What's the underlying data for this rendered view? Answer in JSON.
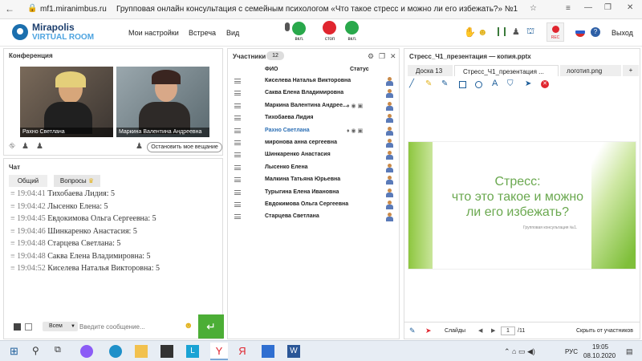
{
  "browser": {
    "url": "mf1.miranimbus.ru",
    "title": "Групповая онлайн консультация с семейным психологом «Что такое стресс и можно ли его избежать?» №1"
  },
  "app": {
    "logo_top": "Mirapolis",
    "logo_bottom": "VIRTUAL ROOM",
    "nav": [
      "Мои настройки",
      "Встреча",
      "Вид"
    ],
    "mic_label": "вкл.",
    "stop_label": "стоп",
    "cam_label": "вкл.",
    "rec_label": "REC",
    "exit_label": "Выход"
  },
  "conference": {
    "title": "Конференция",
    "videos": [
      {
        "name": "Рахно Светлана"
      },
      {
        "name": "Маркина Валентина Андреевна"
      }
    ],
    "stop_button": "Остановить мое вещание"
  },
  "chat": {
    "title": "Чат",
    "tabs": [
      "Общий",
      "Вопросы"
    ],
    "messages": [
      {
        "time": "19:04:41",
        "text": "Тихобаева Лидия: 5"
      },
      {
        "time": "19:04:42",
        "text": "Лысенко Елена: 5"
      },
      {
        "time": "19:04:45",
        "text": "Евдокимова Ольга  Сергеевна: 5"
      },
      {
        "time": "19:04:46",
        "text": "Шинкаренко  Анастасия: 5"
      },
      {
        "time": "19:04:48",
        "text": "Старцева Светлана: 5"
      },
      {
        "time": "19:04:48",
        "text": "Саква Елена Владимировна: 5"
      },
      {
        "time": "19:04:52",
        "text": "Киселева  Наталья Викторовна:  5"
      }
    ],
    "scope": "Всем",
    "placeholder": "Введите сообщение..."
  },
  "participants": {
    "title": "Участники",
    "count": "12",
    "col_name": "ФИО",
    "col_status": "Статус",
    "rows": [
      {
        "name": "Киселева  Наталья Викторовна",
        "color": "#222"
      },
      {
        "name": "Саква Елена Владимировна",
        "color": "#222"
      },
      {
        "name": "Маркина Валентина  Андрее...",
        "color": "#222"
      },
      {
        "name": "Тихобаева Лидия",
        "color": "#222"
      },
      {
        "name": "Рахно Светлана",
        "color": "#2c6fb5"
      },
      {
        "name": "миронова  анна  сергеевна",
        "color": "#222"
      },
      {
        "name": "Шинкаренко  Анастасия",
        "color": "#222"
      },
      {
        "name": "Лысенко Елена",
        "color": "#222"
      },
      {
        "name": "Малкина Татьяна  Юрьевна",
        "color": "#222"
      },
      {
        "name": "Турыгина  Елена  Ивановна",
        "color": "#222"
      },
      {
        "name": "Евдокимова Ольга  Сергеевна",
        "color": "#222"
      },
      {
        "name": "Старцева Светлана",
        "color": "#222"
      }
    ]
  },
  "presentation": {
    "title": "Стресс_Ч1_презентация — копия.pptx",
    "tabs": [
      "Доска 13",
      "Стресс_Ч1_презентация ...",
      "логотип.png",
      "+"
    ],
    "slide_title": "Стресс:\nчто это такое и можно\nли его избежать?",
    "slide_sub": "Групповая консультация №1.",
    "slides_label": "Слайды",
    "page": "1",
    "total": "/11",
    "hide_label": "Скрыть от участников"
  },
  "taskbar": {
    "lang": "РУС",
    "time": "19:05",
    "date": "08.10.2020"
  }
}
